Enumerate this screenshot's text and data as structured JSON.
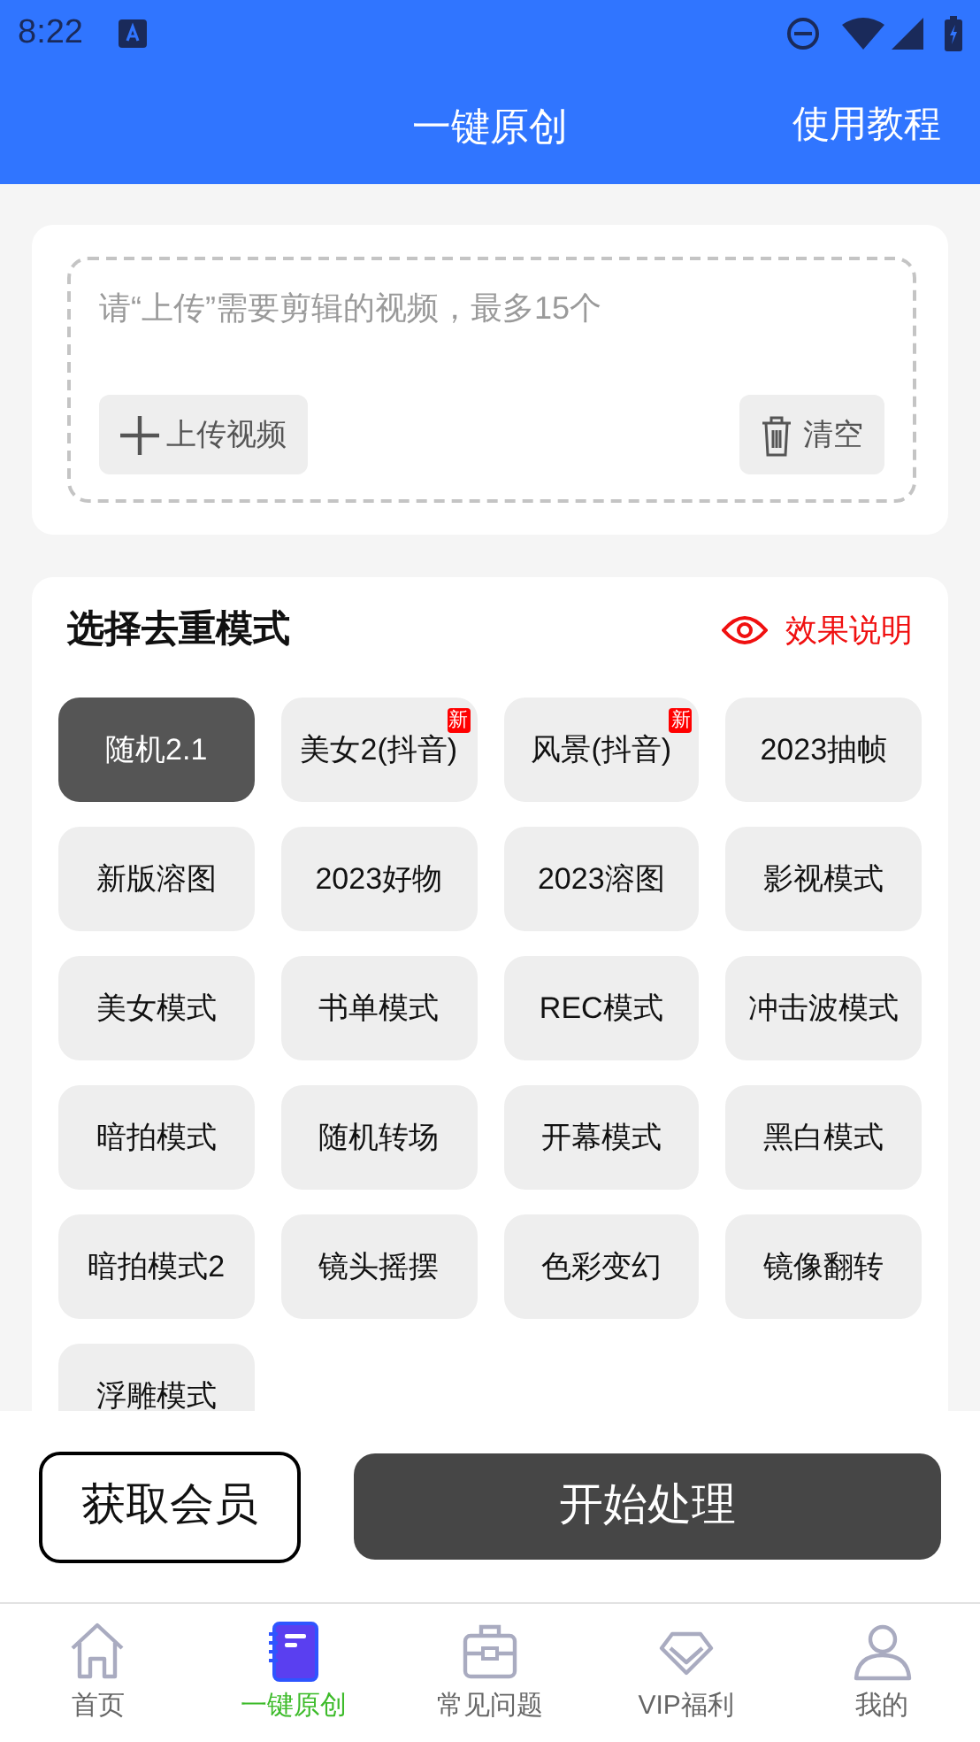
{
  "status_bar": {
    "time": "8:22"
  },
  "header": {
    "title": "一键原创",
    "action": "使用教程"
  },
  "upload": {
    "placeholder": "请“上传”需要剪辑的视频，最多15个",
    "upload_button": "上传视频",
    "clear_button": "清空"
  },
  "modes": {
    "title": "选择去重模式",
    "help_link": "效果说明",
    "items": [
      {
        "label": "随机2.1",
        "selected": true
      },
      {
        "label": "美女2(抖音)",
        "selected": false,
        "badge": "新"
      },
      {
        "label": "风景(抖音)",
        "selected": false,
        "badge": "新"
      },
      {
        "label": "2023抽帧",
        "selected": false
      },
      {
        "label": "新版溶图",
        "selected": false
      },
      {
        "label": "2023好物",
        "selected": false
      },
      {
        "label": "2023溶图",
        "selected": false
      },
      {
        "label": "影视模式",
        "selected": false
      },
      {
        "label": "美女模式",
        "selected": false
      },
      {
        "label": "书单模式",
        "selected": false
      },
      {
        "label": "REC模式",
        "selected": false
      },
      {
        "label": "冲击波模式",
        "selected": false
      },
      {
        "label": "暗拍模式",
        "selected": false
      },
      {
        "label": "随机转场",
        "selected": false
      },
      {
        "label": "开幕模式",
        "selected": false
      },
      {
        "label": "黑白模式",
        "selected": false
      },
      {
        "label": "暗拍模式2",
        "selected": false
      },
      {
        "label": "镜头摇摆",
        "selected": false
      },
      {
        "label": "色彩变幻",
        "selected": false
      },
      {
        "label": "镜像翻转",
        "selected": false
      },
      {
        "label": "浮雕模式",
        "selected": false
      }
    ]
  },
  "actions": {
    "member_button": "获取会员",
    "start_button": "开始处理"
  },
  "bottom_nav": [
    {
      "label": "首页",
      "selected": false
    },
    {
      "label": "一键原创",
      "selected": true
    },
    {
      "label": "常见问题",
      "selected": false
    },
    {
      "label": "VIP福利",
      "selected": false
    },
    {
      "label": "我的",
      "selected": false
    }
  ]
}
